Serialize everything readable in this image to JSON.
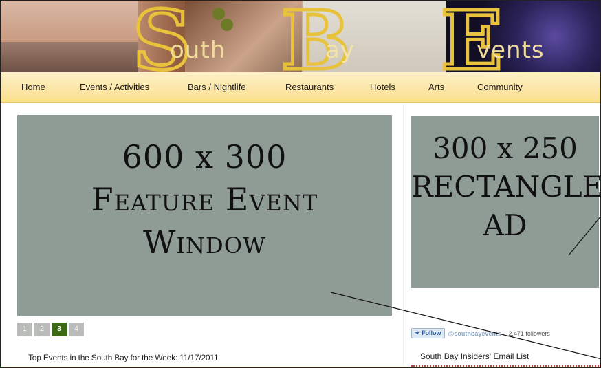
{
  "banner": {
    "letters": {
      "s": "S",
      "b": "B",
      "e": "E"
    },
    "words": {
      "south": "outh",
      "bay": "ay",
      "events": "vents"
    }
  },
  "nav": {
    "items": [
      "Home",
      "Events / Activities",
      "Bars / Nightlife",
      "Restaurants",
      "Hotels",
      "Arts",
      "Community"
    ]
  },
  "feature": {
    "line1": "600 x 300",
    "line2": "Feature Event",
    "line3": "Window"
  },
  "ad": {
    "line1": "300 x 250",
    "line2": "RECTANGLE",
    "line3": "AD"
  },
  "pager": {
    "pages": [
      "1",
      "2",
      "3",
      "4"
    ],
    "active": "3"
  },
  "headline": "Top Events in the South Bay for the Week: 11/17/2011",
  "twitter": {
    "follow_label": "Follow",
    "handle": "@southbayevents",
    "followers": "· 2,471 followers"
  },
  "email_list": "South Bay Insiders' Email List",
  "colors": {
    "accent": "#3d6b14",
    "placeholder": "#8f9c95",
    "nav": "#fbdf8e",
    "gold": "#e8c23a"
  }
}
